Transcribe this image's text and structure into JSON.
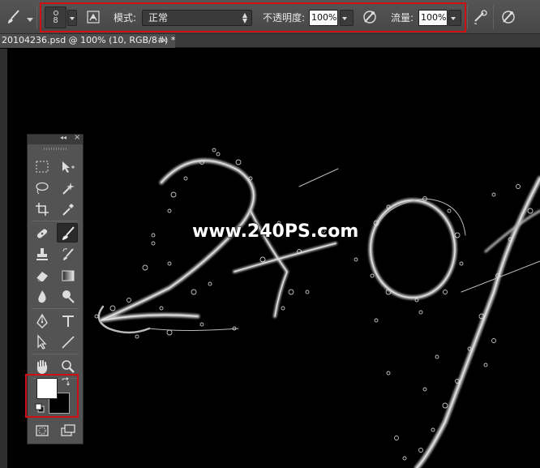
{
  "options_bar": {
    "brush_size": "8",
    "mode_label": "模式:",
    "mode_value": "正常",
    "opacity_label": "不透明度:",
    "opacity_value": "100%",
    "flow_label": "流量:",
    "flow_value": "100%",
    "highlight_color": "#d01010"
  },
  "document_tab": {
    "title": "20104236.psd @ 100% (10, RGB/8#) *",
    "close_glyph": "×"
  },
  "canvas": {
    "watermark": "www.240PS.com",
    "background": "#000000"
  },
  "toolbox": {
    "collapse_glyph": "◂◂",
    "close_glyph": "×",
    "tools": [
      "rectangular-marquee-icon",
      "move-icon",
      "lasso-icon",
      "magic-wand-icon",
      "crop-icon",
      "eyedropper-icon",
      "healing-brush-icon",
      "brush-icon",
      "clone-stamp-icon",
      "history-brush-icon",
      "eraser-icon",
      "gradient-icon",
      "blur-icon",
      "dodge-icon",
      "pen-icon",
      "type-icon",
      "path-selection-icon",
      "line-icon",
      "hand-icon",
      "zoom-icon",
      "quick-mask-icon",
      "screen-mode-icon"
    ],
    "active_tool": "brush-icon",
    "foreground_color": "#ffffff",
    "background_color": "#000000"
  }
}
